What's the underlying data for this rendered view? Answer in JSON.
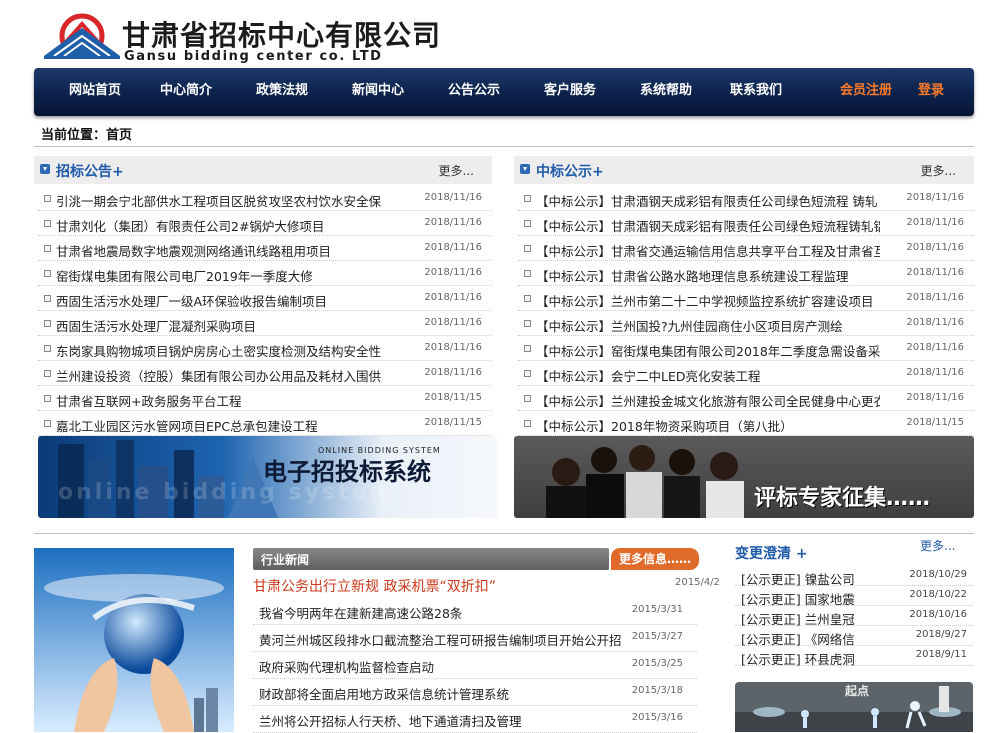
{
  "header": {
    "title_cn": "甘肃省招标中心有限公司",
    "title_en": "Gansu bidding center co. LTD",
    "logo_icon": "company-logo-icon"
  },
  "nav": {
    "items": [
      "网站首页",
      "中心简介",
      "政策法规",
      "新闻中心",
      "公告公示",
      "客户服务",
      "系统帮助",
      "联系我们"
    ],
    "register": "会员注册",
    "separator": "|",
    "login": "登录"
  },
  "breadcrumb": "当前位置：首页",
  "bid_notices": {
    "title": "招标公告+",
    "more": "更多...",
    "items": [
      {
        "title": "引洮一期会宁北部供水工程项目区脱贫攻坚农村饮水安全保",
        "date": "2018/11/16"
      },
      {
        "title": "甘肃刘化（集团）有限责任公司2#锅炉大修项目",
        "date": "2018/11/16"
      },
      {
        "title": "甘肃省地震局数字地震观测网络通讯线路租用项目",
        "date": "2018/11/16"
      },
      {
        "title": "窑街煤电集团有限公司电厂2019年一季度大修",
        "date": "2018/11/16"
      },
      {
        "title": "西固生活污水处理厂一级A环保验收报告编制项目",
        "date": "2018/11/16"
      },
      {
        "title": "西固生活污水处理厂混凝剂采购项目",
        "date": "2018/11/16"
      },
      {
        "title": "东岗家具购物城项目锅炉房房心土密实度检测及结构安全性",
        "date": "2018/11/16"
      },
      {
        "title": "兰州建设投资（控股）集团有限公司办公用品及耗材入围供",
        "date": "2018/11/16"
      },
      {
        "title": "甘肃省互联网+政务服务平台工程",
        "date": "2018/11/15"
      },
      {
        "title": "嘉北工业园区污水管网项目EPC总承包建设工程",
        "date": "2018/11/15"
      }
    ]
  },
  "award_notices": {
    "title": "中标公示+",
    "more": "更多...",
    "items": [
      {
        "title": "【中标公示】甘肃酒钢天成彩铝有限责任公司绿色短流程 铸轧",
        "date": "2018/11/16"
      },
      {
        "title": "【中标公示】甘肃酒钢天成彩铝有限责任公司绿色短流程铸轧铝",
        "date": "2018/11/16"
      },
      {
        "title": "【中标公示】甘肃省交通运输信用信息共享平台工程及甘肃省互",
        "date": "2018/11/16"
      },
      {
        "title": "【中标公示】甘肃省公路水路地理信息系统建设工程监理",
        "date": "2018/11/16"
      },
      {
        "title": "【中标公示】兰州市第二十二中学视频监控系统扩容建设项目",
        "date": "2018/11/16"
      },
      {
        "title": "【中标公示】兰州国投?九州佳园商住小区项目房产测绘",
        "date": "2018/11/16"
      },
      {
        "title": "【中标公示】窑街煤电集团有限公司2018年二季度急需设备采购",
        "date": "2018/11/16"
      },
      {
        "title": "【中标公示】会宁二中LED亮化安装工程",
        "date": "2018/11/16"
      },
      {
        "title": "【中标公示】兰州建投金城文化旅游有限公司全民健身中心更衣",
        "date": "2018/11/16"
      },
      {
        "title": "【中标公示】2018年物资采购项目（第八批）",
        "date": "2018/11/15"
      }
    ]
  },
  "banners": {
    "left_small": "ONLINE BIDDING SYSTEM",
    "left_big": "电子招投标系统",
    "left_shadow": "online bidding system",
    "right_big": "评标专家征集……"
  },
  "industry_news": {
    "title": "行业新闻",
    "more": "更多信息……",
    "headline": {
      "title": "甘肃公务出行立新规 政采机票“双折扣”",
      "date": "2015/4/2"
    },
    "items": [
      {
        "title": "我省今明两年在建新建高速公路28条",
        "date": "2015/3/31"
      },
      {
        "title": "黄河兰州城区段排水口截流整治工程可研报告编制项目开始公开招",
        "date": "2015/3/27"
      },
      {
        "title": "政府采购代理机构监督检查启动",
        "date": "2015/3/25"
      },
      {
        "title": "财政部将全面启用地方政采信息统计管理系统",
        "date": "2015/3/18"
      },
      {
        "title": "兰州将公开招标人行天桥、地下通道清扫及管理",
        "date": "2015/3/16"
      }
    ]
  },
  "changes": {
    "title": "变更澄清 +",
    "more": "更多...",
    "items": [
      {
        "title": "[公示更正] 镍盐公司",
        "date": "2018/10/29"
      },
      {
        "title": "[公示更正] 国家地震",
        "date": "2018/10/22"
      },
      {
        "title": "[公示更正] 兰州皇冠",
        "date": "2018/10/16"
      },
      {
        "title": "[公示更正] 《网络信",
        "date": "2018/9/27"
      },
      {
        "title": "[公示更正] 环县虎洞",
        "date": "2018/9/11"
      }
    ]
  },
  "side_banner": {
    "text": "起点"
  },
  "colors": {
    "nav_dark": "#061433",
    "accent_orange": "#e06a2a",
    "link_blue": "#1e5aa8",
    "headline_red": "#cc3a1c"
  }
}
